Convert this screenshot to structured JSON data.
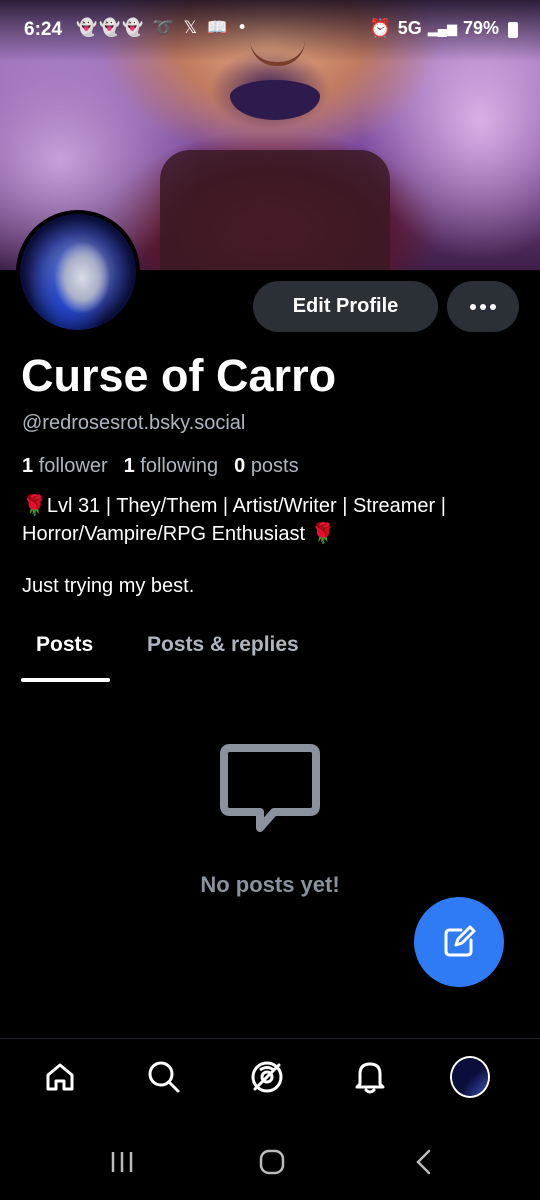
{
  "status_bar": {
    "time": "6:24",
    "notif_icons": "👻👻👻 ➰ 𝕏 📖 •",
    "network": "5G",
    "battery": "79%"
  },
  "profile": {
    "display_name": "Curse of Carro",
    "handle": "@redrosesrot.bsky.social",
    "followers_count": "1",
    "followers_label": "follower",
    "following_count": "1",
    "following_label": "following",
    "posts_count": "0",
    "posts_label": "posts",
    "bio_line1": "🌹Lvl 31 | They/Them | Artist/Writer | Streamer | Horror/Vampire/RPG Enthusiast 🌹",
    "bio_line2": "Just trying my best."
  },
  "actions": {
    "edit_profile_label": "Edit Profile",
    "more_icon": "more-horizontal-icon"
  },
  "tabs": [
    {
      "label": "Posts",
      "active": true
    },
    {
      "label": "Posts & replies",
      "active": false
    }
  ],
  "empty_state": {
    "icon": "message-bubble-icon",
    "text": "No posts yet!"
  },
  "fab": {
    "icon": "compose-icon"
  },
  "bottom_nav": [
    "home-icon",
    "search-icon",
    "feeds-icon",
    "notifications-icon",
    "profile-avatar"
  ],
  "colors": {
    "background": "#000000",
    "accent": "#2f7bf5",
    "button_bg": "#2b2f36",
    "muted_text": "#aeb5bf"
  }
}
